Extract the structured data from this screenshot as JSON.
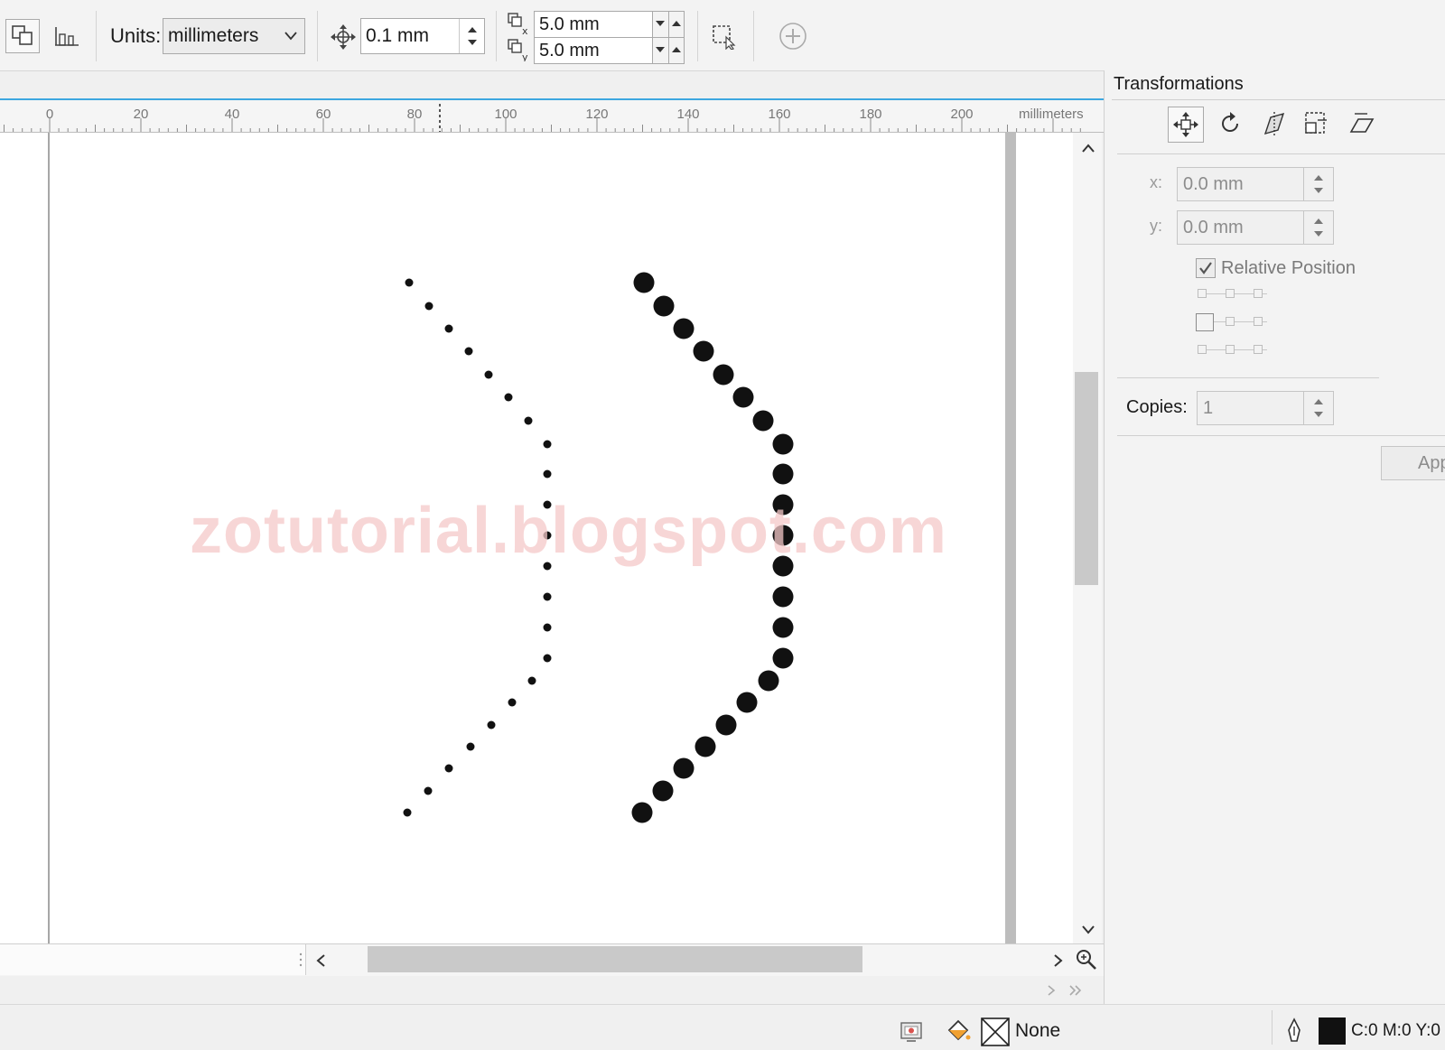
{
  "toolbar": {
    "units_label": "Units:",
    "units_value": "millimeters",
    "nudge_value": "0.1 mm",
    "dup_x_value": "5.0 mm",
    "dup_y_value": "5.0 mm"
  },
  "ruler": {
    "ticks": [
      "0",
      "20",
      "40",
      "60",
      "80",
      "100",
      "120",
      "140",
      "160",
      "180",
      "200"
    ],
    "unit_label": "millimeters"
  },
  "canvas": {
    "watermark": "zotutorial.blogspot.com"
  },
  "docker": {
    "title": "Transformations",
    "x_label": "x:",
    "x_value": "0.0 mm",
    "y_label": "y:",
    "y_value": "0.0 mm",
    "relative_position_label": "Relative Position",
    "relative_position_checked": true,
    "copies_label": "Copies:",
    "copies_value": "1",
    "apply_label": "App"
  },
  "status": {
    "fill_label": "None",
    "color_readout": "C:0 M:0 Y:0"
  },
  "colors": {
    "accent": "#3da7e0",
    "dots": "#111111",
    "watermark": "#f5c9c9"
  }
}
